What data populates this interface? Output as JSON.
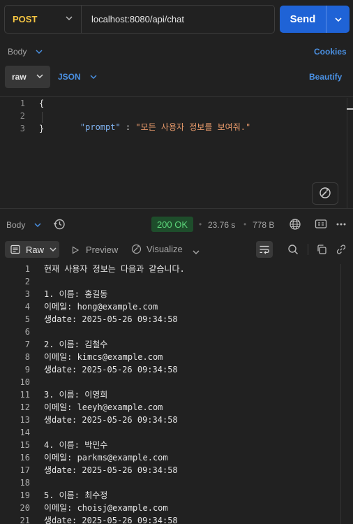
{
  "request": {
    "method": "POST",
    "url": "localhost:8080/api/chat",
    "send_label": "Send"
  },
  "request_tabs": {
    "body_label": "Body",
    "cookies_label": "Cookies",
    "raw_label": "raw",
    "format_label": "JSON",
    "beautify_label": "Beautify"
  },
  "request_body": {
    "lines": [
      {
        "no": "1",
        "text": "{"
      },
      {
        "no": "2",
        "key": "\"prompt\"",
        "sep": " : ",
        "value": "\"모든 사용자 정보를 보여줘.\""
      },
      {
        "no": "3",
        "text": "}"
      }
    ]
  },
  "response_bar": {
    "body_label": "Body",
    "status": "200 OK",
    "time": "23.76 s",
    "size": "778 B",
    "status_color": "#5cd67a"
  },
  "response_tabs": {
    "raw_label": "Raw",
    "preview_label": "Preview",
    "visualize_label": "Visualize"
  },
  "response_body": {
    "lines": [
      {
        "no": "1",
        "text": "현재 사용자 정보는 다음과 같습니다."
      },
      {
        "no": "2",
        "text": ""
      },
      {
        "no": "3",
        "text": "1. 이름: 홍길동"
      },
      {
        "no": "4",
        "text": "이메일: hong@example.com"
      },
      {
        "no": "5",
        "text": "생date: 2025-05-26 09:34:58"
      },
      {
        "no": "6",
        "text": ""
      },
      {
        "no": "7",
        "text": "2. 이름: 김철수"
      },
      {
        "no": "8",
        "text": "이메일: kimcs@example.com"
      },
      {
        "no": "9",
        "text": "생date: 2025-05-26 09:34:58"
      },
      {
        "no": "10",
        "text": ""
      },
      {
        "no": "11",
        "text": "3. 이름: 이영희"
      },
      {
        "no": "12",
        "text": "이메일: leeyh@example.com"
      },
      {
        "no": "13",
        "text": "생date: 2025-05-26 09:34:58"
      },
      {
        "no": "14",
        "text": ""
      },
      {
        "no": "15",
        "text": "4. 이름: 박민수"
      },
      {
        "no": "16",
        "text": "이메일: parkms@example.com"
      },
      {
        "no": "17",
        "text": "생date: 2025-05-26 09:34:58"
      },
      {
        "no": "18",
        "text": ""
      },
      {
        "no": "19",
        "text": "5. 이름: 최수정"
      },
      {
        "no": "20",
        "text": "이메일: choisj@example.com"
      },
      {
        "no": "21",
        "text": "생date: 2025-05-26 09:34:58"
      }
    ]
  },
  "colors": {
    "accent": "#1f63d6",
    "method": "#f5c542",
    "link": "#4a90e2",
    "json_key": "#7fb2f0",
    "json_string": "#e89a6b"
  }
}
